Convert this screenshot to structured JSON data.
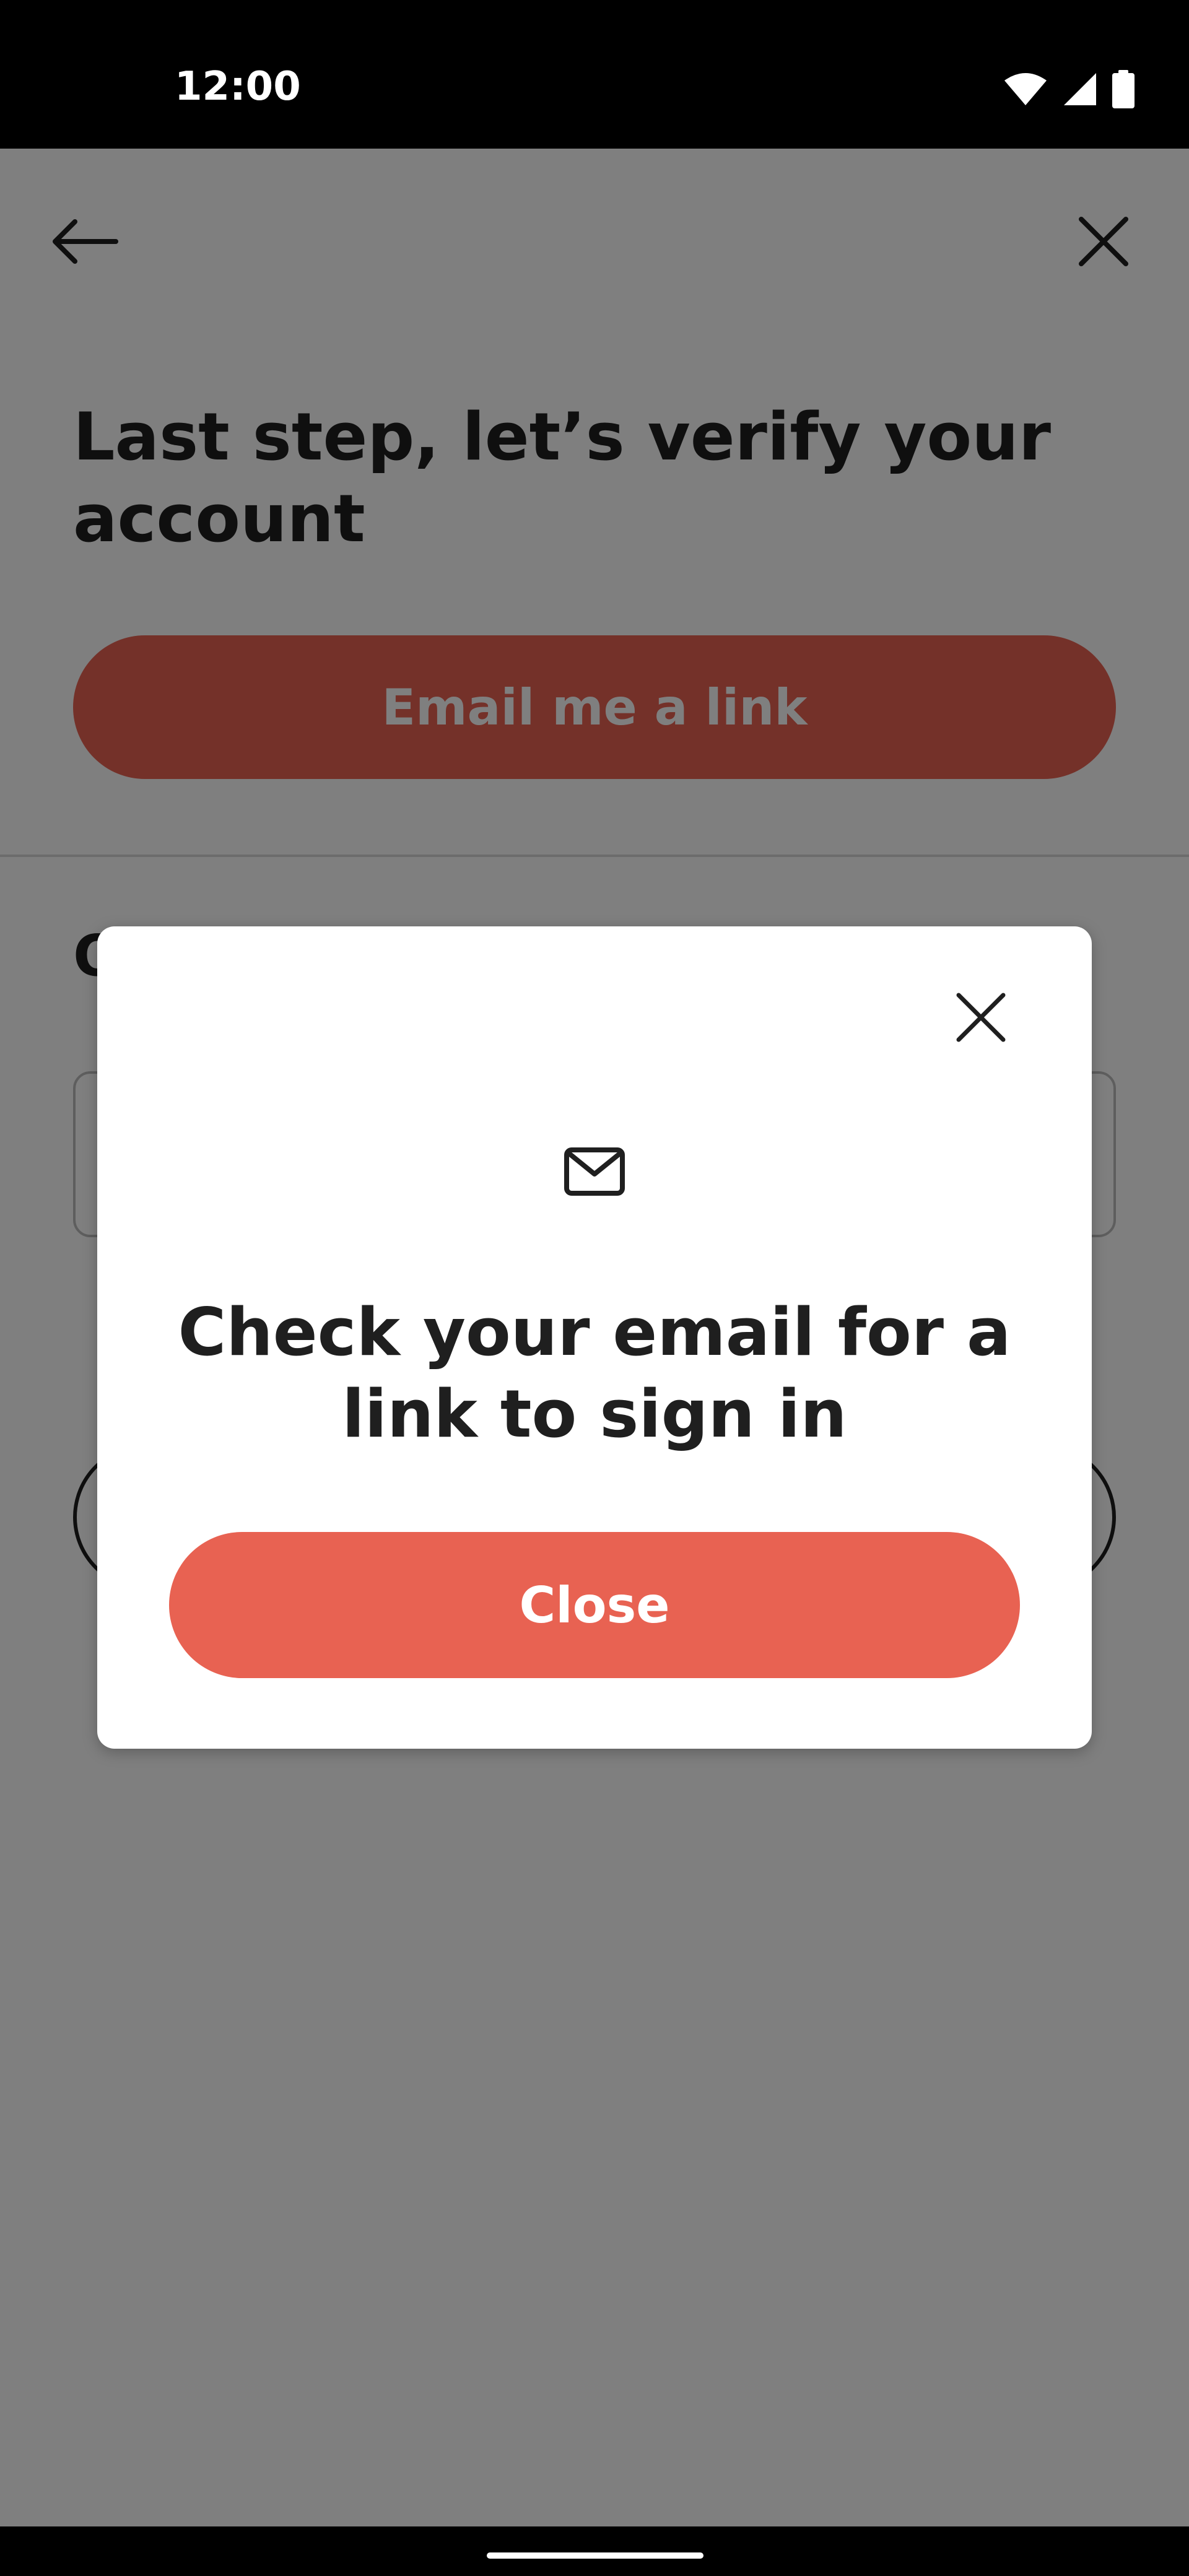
{
  "status_bar": {
    "time": "12:00",
    "icons": [
      "wifi-icon",
      "signal-icon",
      "battery-icon"
    ]
  },
  "page": {
    "title": "Last step, let’s verify your account",
    "email_button_label": "Email me a link",
    "or_label": "Or",
    "icons": {
      "back": "back-arrow-icon",
      "close": "close-icon"
    }
  },
  "dialog": {
    "icon": "mail-icon",
    "title": "Check your email for a link to sign in",
    "close_button_label": "Close"
  },
  "colors": {
    "accent": "#e86252",
    "text": "#1f1f1f",
    "scrim": "rgba(0,0,0,0.5)"
  }
}
